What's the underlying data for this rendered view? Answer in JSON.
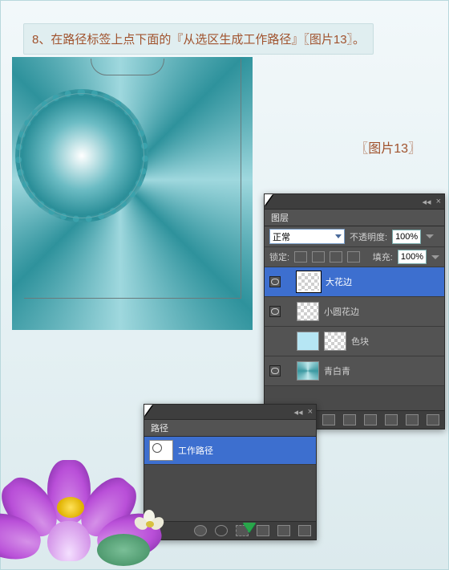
{
  "instruction": {
    "number": "8、",
    "text": "在路径标签上点下面的『从选区生成工作路径』〖图片13〗。"
  },
  "figure_label": "〖图片13〗",
  "layers_panel": {
    "tab": "图层",
    "blend_mode": "正常",
    "opacity_label": "不透明度:",
    "opacity_value": "100%",
    "lock_label": "锁定:",
    "fill_label": "填充:",
    "fill_value": "100%",
    "layers": [
      {
        "name": "大花边",
        "selected": true
      },
      {
        "name": "小圆花边",
        "selected": false
      },
      {
        "name": "色块",
        "selected": false
      },
      {
        "name": "青白青",
        "selected": false
      }
    ]
  },
  "paths_panel": {
    "tab": "路径",
    "item": "工作路径"
  }
}
